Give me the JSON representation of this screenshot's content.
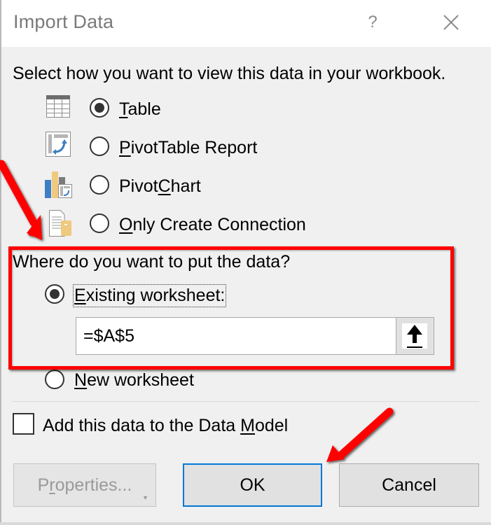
{
  "dialog": {
    "title": "Import Data",
    "help_label": "?",
    "close_icon": "close-icon"
  },
  "view_section": {
    "prompt": "Select how you want to view this data in your workbook.",
    "options": [
      {
        "pre": "",
        "key": "T",
        "post": "able",
        "icon": "table-icon",
        "checked": true
      },
      {
        "pre": "",
        "key": "P",
        "post": "ivotTable Report",
        "icon": "pivottable-icon",
        "checked": false
      },
      {
        "pre": "Pivot",
        "key": "C",
        "post": "hart",
        "icon": "pivotchart-icon",
        "checked": false
      },
      {
        "pre": "",
        "key": "O",
        "post": "nly Create Connection",
        "icon": "connection-icon",
        "checked": false
      }
    ]
  },
  "location_section": {
    "prompt": "Where do you want to put the data?",
    "existing": {
      "pre": "",
      "key": "E",
      "post": "xisting worksheet:",
      "checked": true
    },
    "range_value": "=$A$5",
    "collapse_icon": "collapse-arrow-up-icon",
    "new_sheet": {
      "pre": "",
      "key": "N",
      "post": "ew worksheet",
      "checked": false
    }
  },
  "data_model": {
    "pre": "Add this data to the Data ",
    "key": "M",
    "post": "odel",
    "checked": false
  },
  "buttons": {
    "properties": {
      "pre": "P",
      "key": "r",
      "post": "operties...",
      "disabled": true
    },
    "ok": "OK",
    "cancel": "Cancel"
  },
  "annotations": {
    "highlight_color": "#ff0000",
    "arrows": [
      "arrow-to-location-section",
      "arrow-to-ok-button"
    ]
  }
}
